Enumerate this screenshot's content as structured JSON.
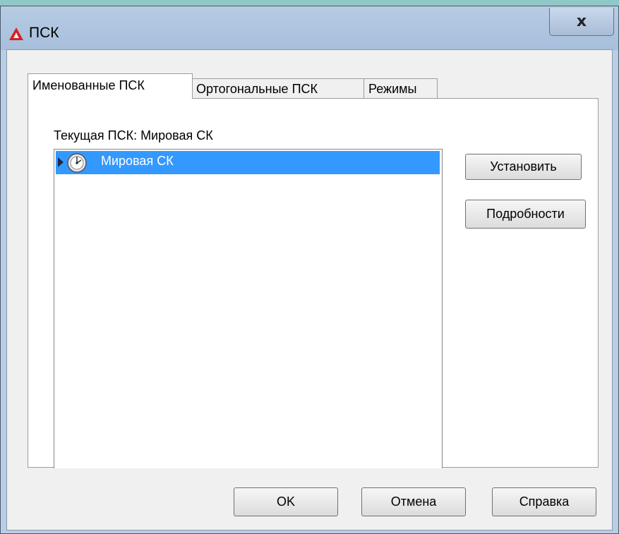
{
  "window": {
    "title": "ПСК",
    "close_glyph": "x"
  },
  "tabs": [
    {
      "label": "Именованные ПСК",
      "active": true
    },
    {
      "label": "Ортогональные ПСК",
      "active": false
    },
    {
      "label": "Режимы",
      "active": false
    }
  ],
  "panel": {
    "current_label": "Текущая ПСК:  Мировая СК",
    "tree_items": [
      {
        "label": "Мировая СК",
        "selected": true,
        "icon": "globe-icon"
      }
    ],
    "set_button": "Установить",
    "details_button": "Подробности"
  },
  "footer": {
    "ok": "OK",
    "cancel": "Отмена",
    "help": "Справка"
  },
  "colors": {
    "selection": "#3399ff",
    "frame": "#b9cde5",
    "app_icon": "#d81e1e"
  }
}
